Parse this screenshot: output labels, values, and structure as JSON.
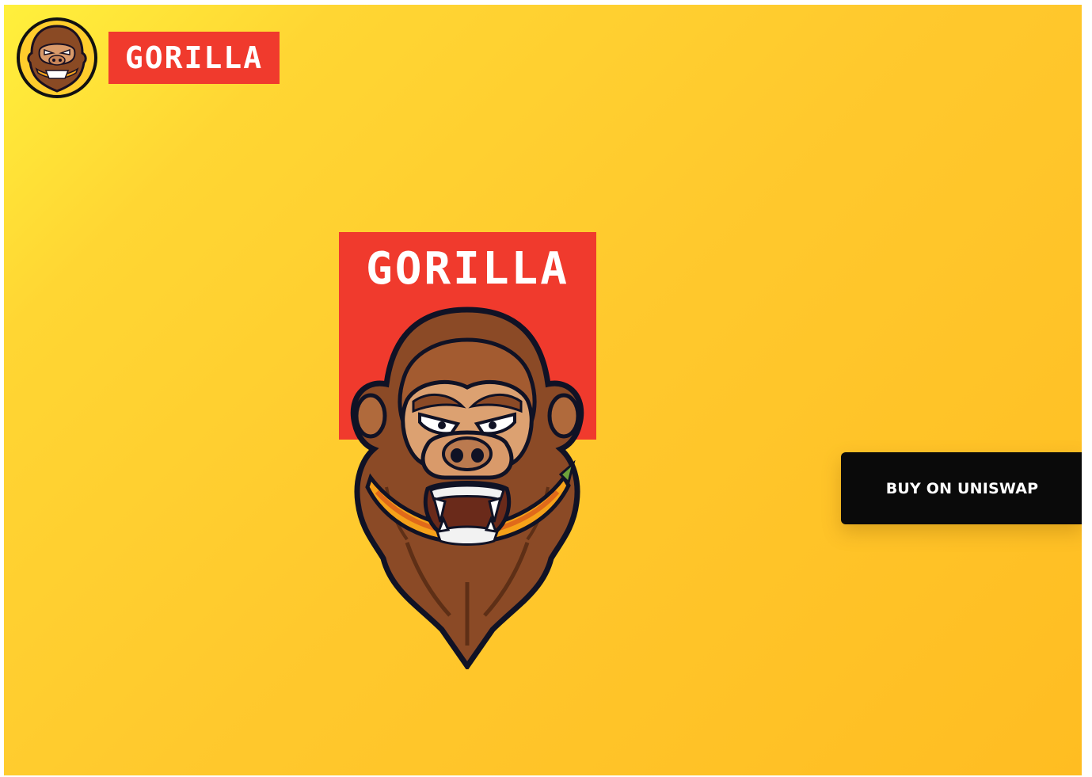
{
  "header": {
    "brand_text": "GORILLA",
    "avatar_icon": "gorilla-head-icon"
  },
  "hero": {
    "emblem_title": "GORILLA",
    "emblem_icon": "gorilla-with-banana-icon"
  },
  "cta": {
    "buy_label": "BUY ON UNISWAP"
  },
  "colors": {
    "background_start": "#fff03c",
    "background_end": "#ffbd22",
    "brand_red": "#f03a2d",
    "button_bg": "#0a0a0a",
    "button_text": "#ffffff"
  }
}
